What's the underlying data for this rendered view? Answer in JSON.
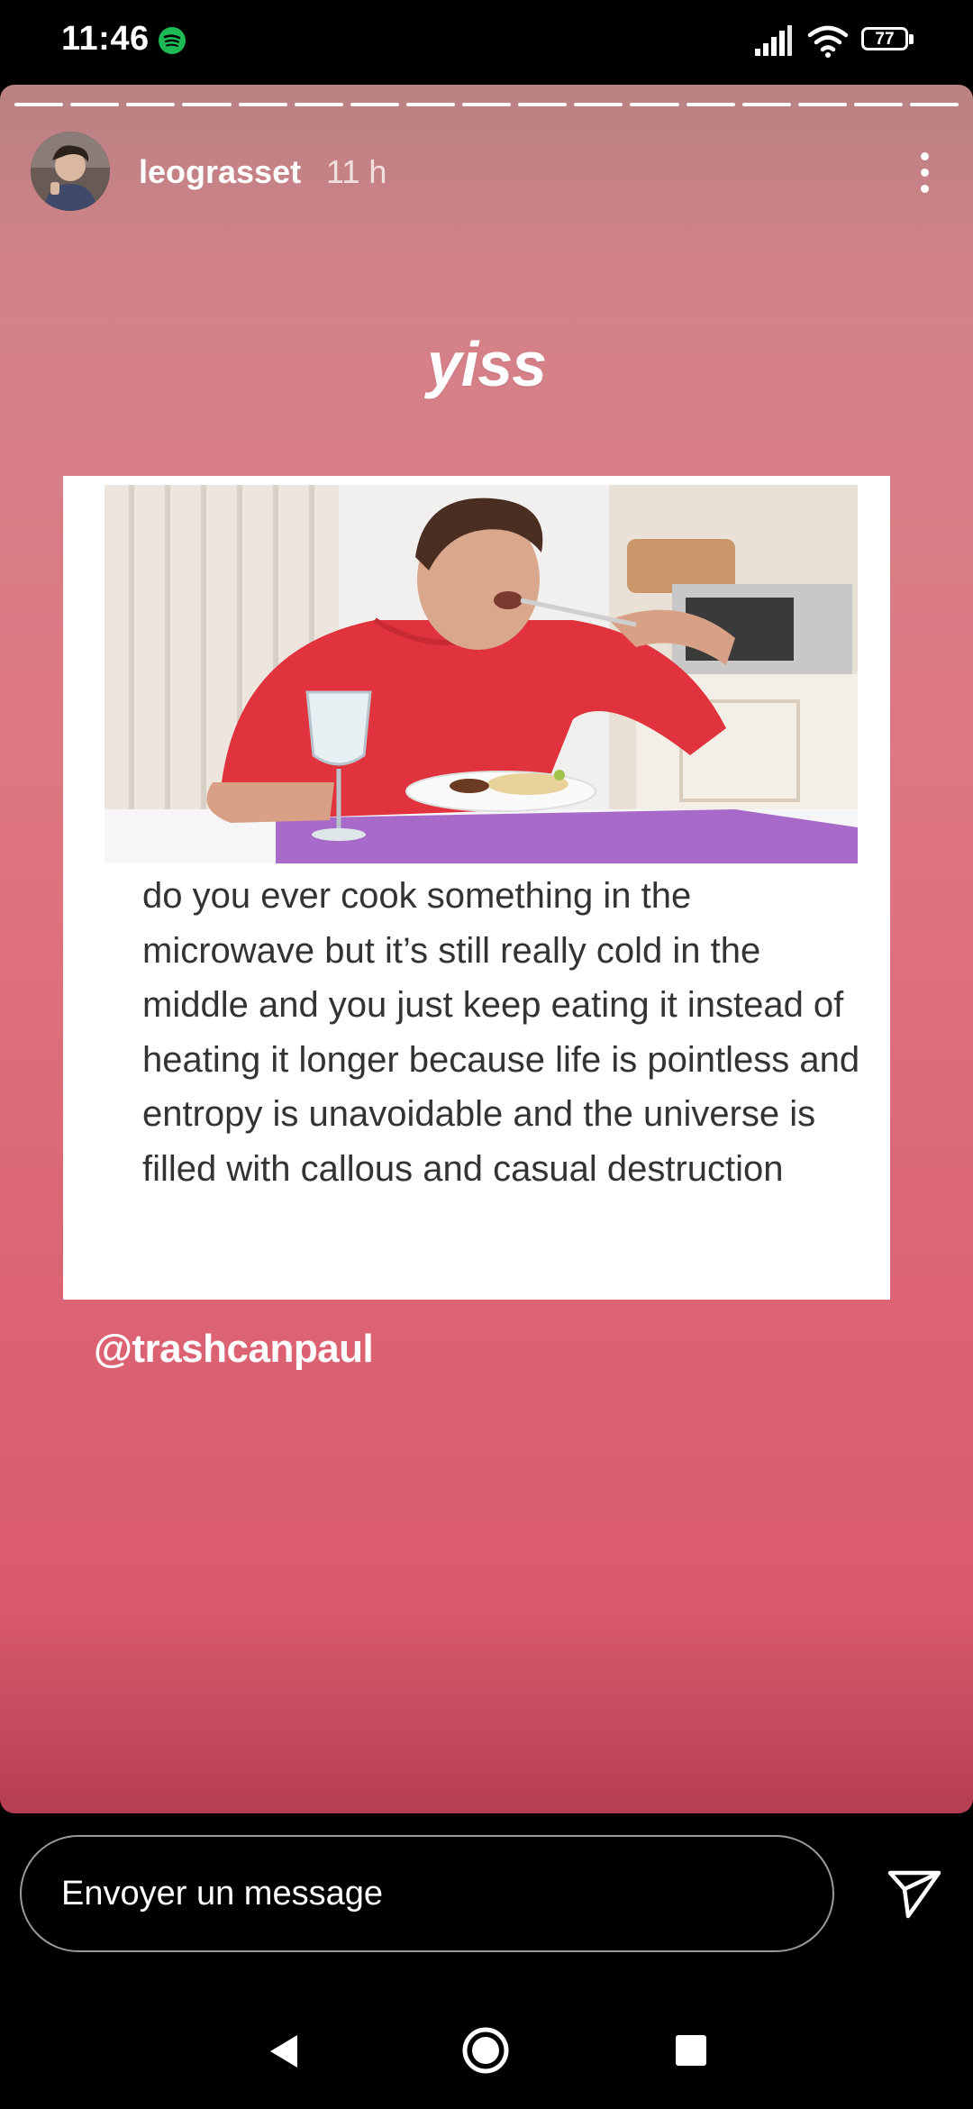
{
  "status_bar": {
    "time": "11:46",
    "battery": "77"
  },
  "story": {
    "progress": {
      "segments": 17,
      "completed": 17
    },
    "username": "leograsset",
    "time_ago": "11 h",
    "caption": "yiss",
    "meme_text": "do you ever cook something in the microwave but it’s still really cold in the middle and you just keep eating it instead of heating it longer because life is pointless and entropy is unavoidable and the universe is filled with callous and casual destruction",
    "mention": "@trashcanpaul"
  },
  "reply": {
    "placeholder": "Envoyer un message"
  },
  "colors": {
    "story_gradient_top": "#b98283",
    "story_gradient_bottom": "#b63e52",
    "spotify_green": "#1db954"
  },
  "icons": [
    "spotify-icon",
    "signal-icon",
    "wifi-icon",
    "battery-icon",
    "more-options-icon",
    "send-icon",
    "back-icon",
    "home-icon",
    "recents-icon"
  ]
}
